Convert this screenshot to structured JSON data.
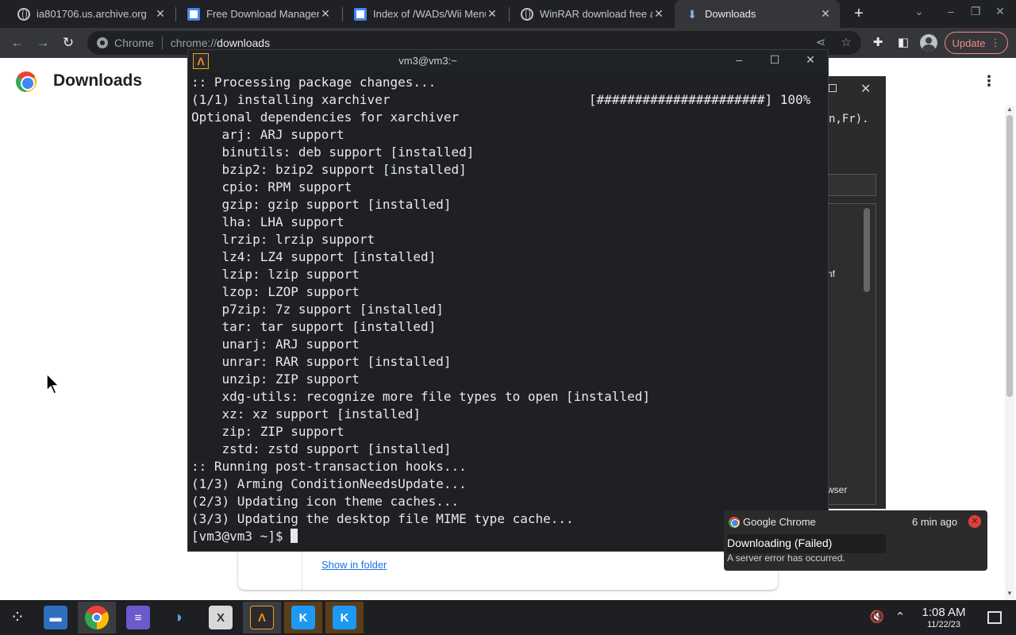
{
  "browser": {
    "tabs": [
      {
        "title": "ia801706.us.archive.org",
        "icon": "globe-icon"
      },
      {
        "title": "Free Download Manager",
        "icon": "doc-icon"
      },
      {
        "title": "Index of /WADs/Wii Menu",
        "icon": "doc-icon"
      },
      {
        "title": "WinRAR download free and",
        "icon": "globe-icon"
      },
      {
        "title": "Downloads",
        "icon": "download-icon",
        "active": true
      }
    ],
    "omnibox": {
      "site": "Chrome",
      "scheme": "chrome://",
      "host": "downloads"
    },
    "update_label": "Update",
    "accent": "#f28b82"
  },
  "page": {
    "title": "Downloads",
    "show_in_folder": "Show in folder"
  },
  "background_window": {
    "text_fragment": "n,Fr).",
    "item_fragment": "nf",
    "item_fragment_2": "wser"
  },
  "terminal": {
    "title": "vm3@vm3:~",
    "lines": [
      ":: Processing package changes...",
      "(1/1) installing xarchiver                          [######################] 100%",
      "Optional dependencies for xarchiver",
      "    arj: ARJ support",
      "    binutils: deb support [installed]",
      "    bzip2: bzip2 support [installed]",
      "    cpio: RPM support",
      "    gzip: gzip support [installed]",
      "    lha: LHA support",
      "    lrzip: lrzip support",
      "    lz4: LZ4 support [installed]",
      "    lzip: lzip support",
      "    lzop: LZOP support",
      "    p7zip: 7z support [installed]",
      "    tar: tar support [installed]",
      "    unarj: ARJ support",
      "    unrar: RAR support [installed]",
      "    unzip: ZIP support",
      "    xdg-utils: recognize more file types to open [installed]",
      "    xz: xz support [installed]",
      "    zip: ZIP support",
      "    zstd: zstd support [installed]",
      ":: Running post-transaction hooks...",
      "(1/3) Arming ConditionNeedsUpdate...",
      "(2/3) Updating icon theme caches...",
      "(3/3) Updating the desktop file MIME type cache..."
    ],
    "prompt": "[vm3@vm3 ~]$ "
  },
  "notification": {
    "app": "Google Chrome",
    "time": "6 min ago",
    "title": "Downloading (Failed)",
    "body": "A server error has occurred."
  },
  "taskbar": {
    "clock_time": "1:08 AM",
    "clock_date": "11/22/23",
    "apps": [
      "files-icon",
      "chrome-icon",
      "discover-icon",
      "dolphin-emu-icon",
      "xarchiver-icon",
      "terminal-icon",
      "kde-app-icon",
      "kde-app-icon"
    ]
  }
}
